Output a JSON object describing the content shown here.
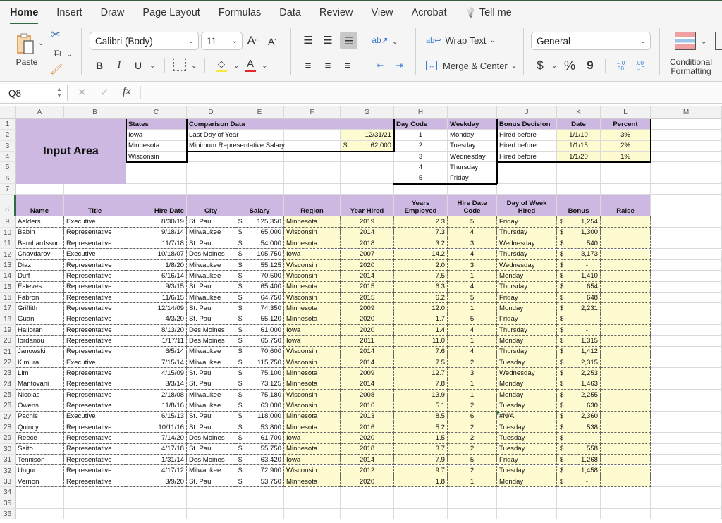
{
  "ribbon_tabs": [
    "Home",
    "Insert",
    "Draw",
    "Page Layout",
    "Formulas",
    "Data",
    "Review",
    "View",
    "Acrobat",
    "Tell me"
  ],
  "ribbon": {
    "paste_label": "Paste",
    "font_name": "Calibri (Body)",
    "font_size": "11",
    "wrap_text_label": "Wrap Text",
    "merge_center_label": "Merge & Center",
    "number_format": "General",
    "conditional_formatting_label": "Conditional\nFormatting",
    "bold": "B",
    "italic": "I",
    "underline": "U",
    "currency": "$",
    "percent": "%",
    "comma": "9",
    "increase_font": "A",
    "decrease_font": "A",
    "font_color": "A"
  },
  "formula_bar": {
    "name_box": "Q8",
    "fx": "fx",
    "formula": ""
  },
  "columns": [
    "A",
    "B",
    "C",
    "D",
    "E",
    "F",
    "G",
    "H",
    "I",
    "J",
    "K",
    "L",
    "M"
  ],
  "rows": [
    "1",
    "2",
    "3",
    "4",
    "5",
    "6",
    "7",
    "8",
    "9",
    "10",
    "11",
    "12",
    "13",
    "14",
    "15",
    "16",
    "17",
    "18",
    "19",
    "20",
    "21",
    "22",
    "23",
    "24",
    "25",
    "26",
    "27",
    "28",
    "29",
    "30",
    "31",
    "32",
    "33",
    "34",
    "35",
    "36"
  ],
  "input_area": {
    "title": "Input Area",
    "states_header": "States",
    "states": [
      "Iowa",
      "Minnesota",
      "Wisconsin"
    ],
    "comparison_header": "Comparison Data",
    "comparison": [
      {
        "label": "Last Day of Year",
        "currency": "",
        "value": "12/31/21"
      },
      {
        "label": "Minimum Representative Salary",
        "currency": "$",
        "value": "62,000"
      }
    ],
    "day_code_header": "Day Code",
    "weekday_header": "Weekday",
    "days": [
      {
        "code": "1",
        "day": "Monday"
      },
      {
        "code": "2",
        "day": "Tuesday"
      },
      {
        "code": "3",
        "day": "Wednesday"
      },
      {
        "code": "4",
        "day": "Thursday"
      },
      {
        "code": "5",
        "day": "Friday"
      }
    ],
    "bonus_header": "Bonus Decision",
    "date_header": "Date",
    "percent_header": "Percent",
    "bonus": [
      {
        "label": "Hired before",
        "date": "1/1/10",
        "percent": "3%"
      },
      {
        "label": "Hired before",
        "date": "1/1/15",
        "percent": "2%"
      },
      {
        "label": "Hired before",
        "date": "1/1/20",
        "percent": "1%"
      }
    ]
  },
  "table": {
    "headers": {
      "name": "Name",
      "title": "Title",
      "hire_date": "Hire Date",
      "city": "City",
      "salary": "Salary",
      "region": "Region",
      "year_hired": "Year Hired",
      "years_employed_1": "Years",
      "years_employed_2": "Employed",
      "hire_code_1": "Hire Date",
      "hire_code_2": "Code",
      "dow_1": "Day of Week",
      "dow_2": "Hired",
      "bonus": "Bonus",
      "raise": "Raise"
    },
    "rows": [
      [
        "Aalders",
        "Executive",
        "8/30/19",
        "St. Paul",
        "125,350",
        "Minnesota",
        "2019",
        "2.3",
        "5",
        "Friday",
        "1,254"
      ],
      [
        "Babin",
        "Representative",
        "9/18/14",
        "Milwaukee",
        "65,000",
        "Wisconsin",
        "2014",
        "7.3",
        "4",
        "Thursday",
        "1,300"
      ],
      [
        "Bernhardsson",
        "Representative",
        "11/7/18",
        "St. Paul",
        "54,000",
        "Minnesota",
        "2018",
        "3.2",
        "3",
        "Wednesday",
        "540"
      ],
      [
        "Chavdarov",
        "Executive",
        "10/18/07",
        "Des Moines",
        "105,750",
        "Iowa",
        "2007",
        "14.2",
        "4",
        "Thursday",
        "3,173"
      ],
      [
        "Diaz",
        "Representative",
        "1/8/20",
        "Milwaukee",
        "55,125",
        "Wisconsin",
        "2020",
        "2.0",
        "3",
        "Wednesday",
        "-"
      ],
      [
        "Duff",
        "Representative",
        "6/16/14",
        "Milwaukee",
        "70,500",
        "Wisconsin",
        "2014",
        "7.5",
        "1",
        "Monday",
        "1,410"
      ],
      [
        "Esteves",
        "Representative",
        "9/3/15",
        "St. Paul",
        "65,400",
        "Minnesota",
        "2015",
        "6.3",
        "4",
        "Thursday",
        "654"
      ],
      [
        "Fabron",
        "Representative",
        "11/6/15",
        "Milwaukee",
        "64,750",
        "Wisconsin",
        "2015",
        "6.2",
        "5",
        "Friday",
        "648"
      ],
      [
        "Griffith",
        "Representative",
        "12/14/09",
        "St. Paul",
        "74,350",
        "Minnesota",
        "2009",
        "12.0",
        "1",
        "Monday",
        "2,231"
      ],
      [
        "Guan",
        "Representative",
        "4/3/20",
        "St. Paul",
        "55,120",
        "Minnesota",
        "2020",
        "1.7",
        "5",
        "Friday",
        "-"
      ],
      [
        "Halloran",
        "Representative",
        "8/13/20",
        "Des Moines",
        "61,000",
        "Iowa",
        "2020",
        "1.4",
        "4",
        "Thursday",
        "-"
      ],
      [
        "Iordanou",
        "Representative",
        "1/17/11",
        "Des Moines",
        "65,750",
        "Iowa",
        "2011",
        "11.0",
        "1",
        "Monday",
        "1,315"
      ],
      [
        "Janowski",
        "Representative",
        "6/5/14",
        "Milwaukee",
        "70,600",
        "Wisconsin",
        "2014",
        "7.6",
        "4",
        "Thursday",
        "1,412"
      ],
      [
        "Kimura",
        "Executive",
        "7/15/14",
        "Milwaukee",
        "115,750",
        "Wisconsin",
        "2014",
        "7.5",
        "2",
        "Tuesday",
        "2,315"
      ],
      [
        "Lim",
        "Representative",
        "4/15/09",
        "St. Paul",
        "75,100",
        "Minnesota",
        "2009",
        "12.7",
        "3",
        "Wednesday",
        "2,253"
      ],
      [
        "Mantovani",
        "Representative",
        "3/3/14",
        "St. Paul",
        "73,125",
        "Minnesota",
        "2014",
        "7.8",
        "1",
        "Monday",
        "1,463"
      ],
      [
        "Nicolas",
        "Representative",
        "2/18/08",
        "Milwaukee",
        "75,180",
        "Wisconsin",
        "2008",
        "13.9",
        "1",
        "Monday",
        "2,255"
      ],
      [
        "Owens",
        "Representative",
        "11/8/16",
        "Milwaukee",
        "63,000",
        "Wisconsin",
        "2016",
        "5.1",
        "2",
        "Tuesday",
        "630"
      ],
      [
        "Pachis",
        "Executive",
        "6/15/13",
        "St. Paul",
        "118,000",
        "Minnesota",
        "2013",
        "8.5",
        "6",
        "#N/A",
        "2,360"
      ],
      [
        "Quincy",
        "Representative",
        "10/11/16",
        "St. Paul",
        "53,800",
        "Minnesota",
        "2016",
        "5.2",
        "2",
        "Tuesday",
        "538"
      ],
      [
        "Reece",
        "Representative",
        "7/14/20",
        "Des Moines",
        "61,700",
        "Iowa",
        "2020",
        "1.5",
        "2",
        "Tuesday",
        "-"
      ],
      [
        "Saito",
        "Representative",
        "4/17/18",
        "St. Paul",
        "55,750",
        "Minnesota",
        "2018",
        "3.7",
        "2",
        "Tuesday",
        "558"
      ],
      [
        "Tennison",
        "Representative",
        "1/31/14",
        "Des Moines",
        "63,420",
        "Iowa",
        "2014",
        "7.9",
        "5",
        "Friday",
        "1,268"
      ],
      [
        "Ungur",
        "Representative",
        "4/17/12",
        "Milwaukee",
        "72,900",
        "Wisconsin",
        "2012",
        "9.7",
        "2",
        "Tuesday",
        "1,458"
      ],
      [
        "Vernon",
        "Representative",
        "3/9/20",
        "St. Paul",
        "53,750",
        "Minnesota",
        "2020",
        "1.8",
        "1",
        "Monday",
        "-"
      ]
    ],
    "currency_symbol": "$"
  },
  "colors": {
    "header_purple": "#cdb8e2",
    "input_yellow": "#fffbd0",
    "active_tab_underline": "#2e6b3f"
  }
}
